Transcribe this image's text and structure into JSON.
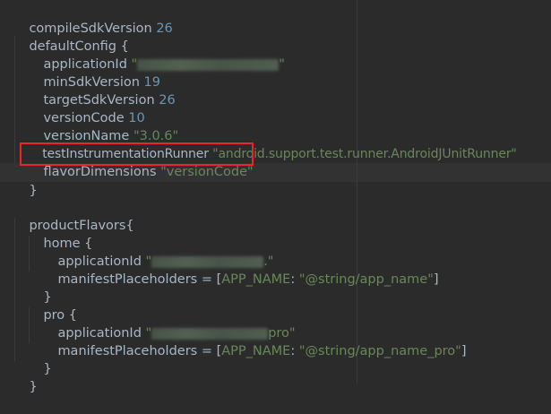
{
  "code": {
    "l1": {
      "key": "compileSdkVersion",
      "value": "26"
    },
    "l2": {
      "text": "defaultConfig {"
    },
    "l3": {
      "key": "applicationId",
      "quote_open": "\"",
      "quote_close": "\""
    },
    "l4": {
      "key": "minSdkVersion",
      "value": "19"
    },
    "l5": {
      "key": "targetSdkVersion",
      "value": "26"
    },
    "l6": {
      "key": "versionCode",
      "value": "10"
    },
    "l7": {
      "key": "versionName",
      "value": "\"3.0.6\""
    },
    "l8": {
      "key": "testInstrumentationRunner",
      "value": "\"android.support.test.runner.AndroidJUnitRunner\""
    },
    "l9": {
      "key": "flavorDimensions",
      "value": "\"versionCode\""
    },
    "l10": {
      "text": "}"
    },
    "l11": {
      "text": "productFlavors{"
    },
    "l12": {
      "text": "home {"
    },
    "l13": {
      "key": "applicationId",
      "quote_open": "\"",
      "quote_close": ".\""
    },
    "l14": {
      "key": "manifestPlaceholders = [",
      "map_key": "APP_NAME",
      "colon": ": ",
      "value": "\"@string/app_name\"",
      "close": "]"
    },
    "l15": {
      "text": "}"
    },
    "l16": {
      "text": "pro {"
    },
    "l17": {
      "key": "applicationId",
      "quote_open": "\"",
      "suffix": "pro\""
    },
    "l18": {
      "key": "manifestPlaceholders = [",
      "map_key": "APP_NAME",
      "colon": ": ",
      "value": "\"@string/app_name_pro\"",
      "close": "]"
    },
    "l19": {
      "text": "}"
    },
    "l20": {
      "text": "}"
    }
  },
  "colors": {
    "background": "#2b2b2b",
    "text": "#a9b7c6",
    "number": "#6897bb",
    "string": "#6a8759",
    "highlight_border": "#e8262c"
  }
}
